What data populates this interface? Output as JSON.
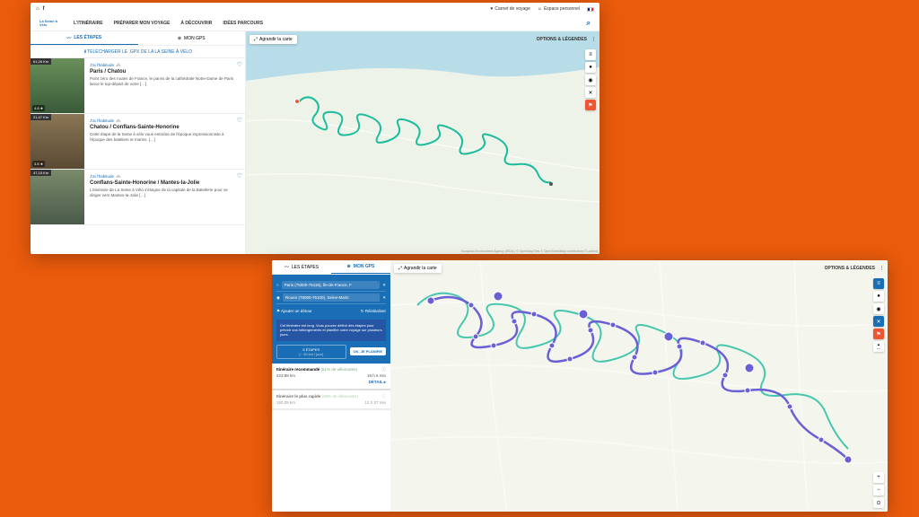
{
  "topbar": {
    "carnet": "Carnet de voyage",
    "espace": "Espace personnel"
  },
  "logo": "La Seine à Vélo",
  "nav": {
    "i0": "L'ITINÉRAIRE",
    "i1": "PRÉPARER MON VOYAGE",
    "i2": "À DÉCOUVRIR",
    "i3": "IDÉES PARCOURS"
  },
  "tabs": {
    "etapes": "LES ÉTAPES",
    "gps": "MON GPS"
  },
  "download": "TÉLÉCHARGER LE .GPX DE LA LA SEINE À VÉLO",
  "cards": [
    {
      "km": "61,26 Km",
      "rating": "4.8 ★",
      "cat": "J'ai l'habitude",
      "title": "Paris / Chatou",
      "desc": "Point zéro des routes de France, le parvis de la cathédrale Notre-Dame de Paris lance le top-départ de votre […]"
    },
    {
      "km": "21,47 Km",
      "rating": "3.8 ★",
      "cat": "J'ai l'habitude",
      "title": "Chatou / Conflans-Sainte-Honorine",
      "desc": "Cette étape de la Seine à vélo vous entraîne de l'époque impressionniste à l'époque des bateliers et marins. […]"
    },
    {
      "km": "47,15 Km",
      "rating": "",
      "cat": "J'ai l'habitude",
      "title": "Conflans-Sainte-Honorine / Mantes-la-Jolie",
      "desc": "L'itinéraire de La Seine à Vélo s'éloigne de la capitale de la Batellerie pour se diriger vers Mantes-la-Jolie […]"
    }
  ],
  "map": {
    "agrandir": "Agrandir la carte",
    "options": "OPTIONS & LÉGENDES",
    "attrib": "European Environment Agency (EEA) | © OpenMapTiles © OpenStreetMap contributors © Lantmä"
  },
  "gps": {
    "from": "Paris (75000-75116), Île-de-France, F",
    "to": "Rouen (76000-76100), Seine-Mariti",
    "add": "Ajouter un détour",
    "reinit": "Réinitialiser",
    "tip": "Cet itinéraire est long. Vous pouvez définir des étapes pour prévoir vos hébergements et planifier votre voyage sur plusieurs jours.",
    "stepslabel": "5 ÉTAPES",
    "stepssub": "(~ 45 km / jour)",
    "ok": "OK, JE PLANIFIE"
  },
  "results": [
    {
      "label": "Itinéraire recommandé",
      "pct": "(61% de véloroutes)",
      "dist": "223,88 km",
      "time": "18 h 6 min",
      "detail": "DÉTAIL ▸"
    },
    {
      "label": "Itinéraire le plus rapide",
      "pct": "(28% de véloroutes)",
      "dist": "150,09 km",
      "time": "12 h 37 min",
      "detail": ""
    }
  ]
}
